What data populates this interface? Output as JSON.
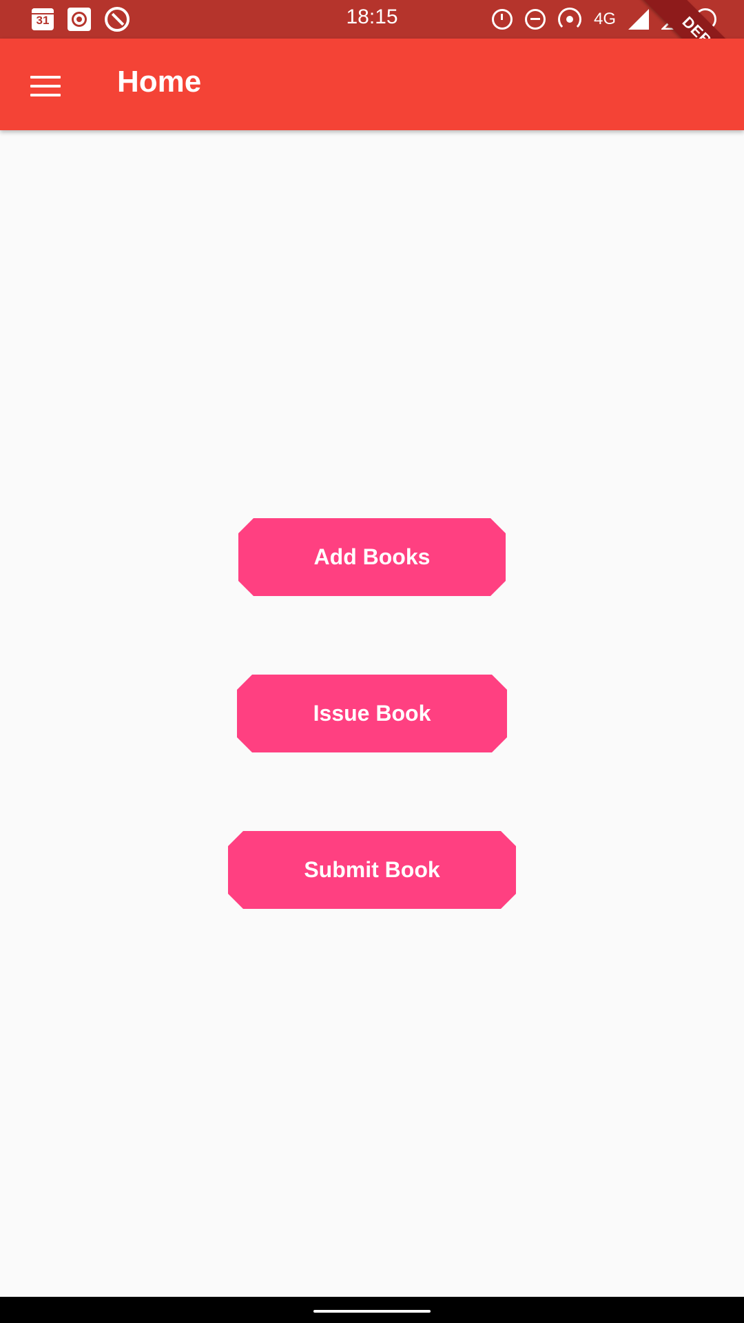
{
  "status_bar": {
    "time": "18:15",
    "calendar_day": "31",
    "network": "4G",
    "left_icons": [
      "calendar-icon",
      "target-icon",
      "q-icon"
    ],
    "right_icons": [
      "alarm-icon",
      "do-not-disturb-icon",
      "hotspot-icon",
      "signal-icon",
      "signal-icon",
      "battery-icon"
    ]
  },
  "debug_banner": "DEBUG",
  "app_bar": {
    "title": "Home",
    "menu_icon": "hamburger-menu-icon"
  },
  "actions": [
    {
      "label": "Add Books"
    },
    {
      "label": "Issue Book"
    },
    {
      "label": "Submit Book"
    }
  ],
  "colors": {
    "status_bar": "#B5342C",
    "app_bar": "#F44336",
    "button": "#FF4081",
    "background": "#FAFAFA"
  }
}
